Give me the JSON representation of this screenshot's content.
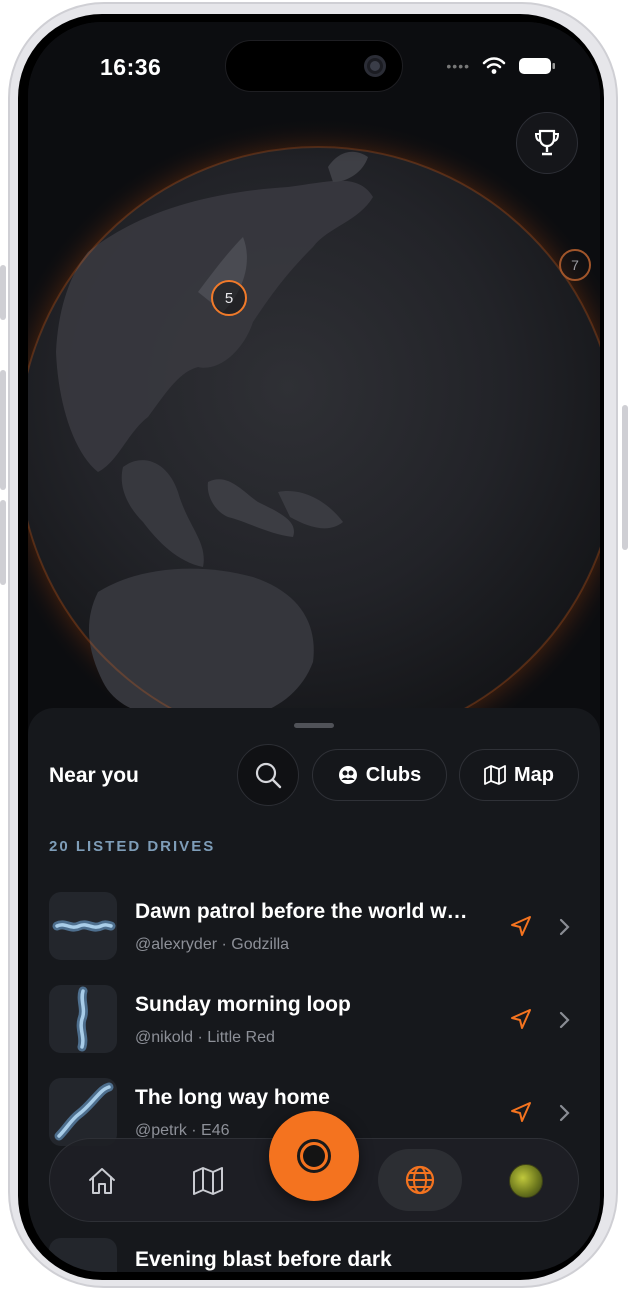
{
  "status_bar": {
    "time": "16:36",
    "signal_dots": "••••"
  },
  "globe": {
    "pins": [
      {
        "count": "5"
      },
      {
        "count": "7"
      }
    ]
  },
  "sheet": {
    "title": "Near you",
    "clubs_label": "Clubs",
    "map_label": "Map",
    "section_label": "20 LISTED DRIVES",
    "drives": [
      {
        "title": "Dawn patrol before the world w…",
        "user": "@alexryder",
        "car": "Godzilla"
      },
      {
        "title": "Sunday morning loop",
        "user": "@nikold",
        "car": "Little Red"
      },
      {
        "title": "The long way home",
        "user": "@petrk",
        "car": "E46"
      }
    ],
    "evening_title": "Evening blast before dark"
  },
  "colors": {
    "accent": "#f4731f",
    "sheet_bg": "#16181c",
    "section_label": "#7e9db8"
  },
  "icons": [
    "trophy-icon",
    "search-icon",
    "clubs-icon",
    "map-icon",
    "navigate-icon",
    "chevron-right-icon",
    "home-icon",
    "map-tab-icon",
    "record-icon",
    "globe-icon",
    "avatar"
  ]
}
